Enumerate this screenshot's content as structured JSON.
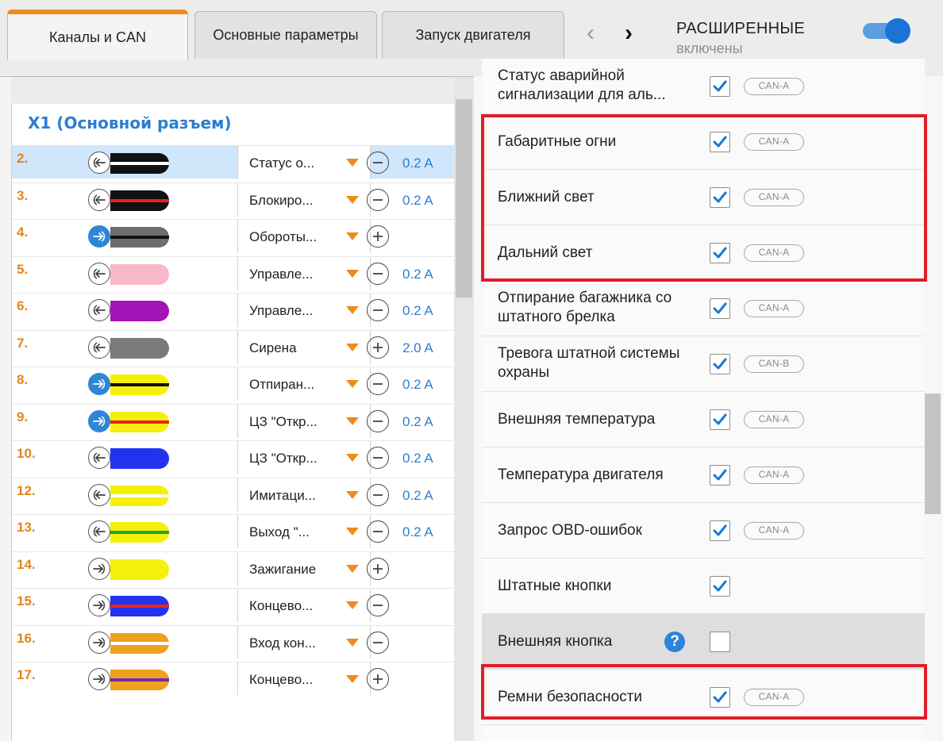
{
  "tabs": [
    {
      "label": "Каналы и CAN",
      "active": true
    },
    {
      "label": "Основные параметры",
      "active": false
    },
    {
      "label": "Запуск двигателя",
      "active": false
    }
  ],
  "nav": {
    "prev": "‹",
    "next": "›"
  },
  "advanced": {
    "title": "РАСШИРЕННЫЕ",
    "subtitle": "включены",
    "enabled": true
  },
  "connector": {
    "title": "X1 (Основной разъем)",
    "channels": [
      {
        "num": "2.",
        "dir": "out",
        "dir_active": false,
        "wire": "#111111",
        "stripe": "#ffffff",
        "func": "Статус о...",
        "polarity": "minus",
        "current": "0.2 A",
        "selected": true
      },
      {
        "num": "3.",
        "dir": "out",
        "dir_active": false,
        "wire": "#111111",
        "stripe": "#e8231c",
        "func": "Блокиро...",
        "polarity": "minus",
        "current": "0.2 A"
      },
      {
        "num": "4.",
        "dir": "in",
        "dir_active": true,
        "wire": "#6d6d6d",
        "stripe": "#111111",
        "func": "Обороты...",
        "polarity": "plus",
        "current": ""
      },
      {
        "num": "5.",
        "dir": "out",
        "dir_active": false,
        "wire": "#f7b8c8",
        "stripe": "",
        "func": "Управле...",
        "polarity": "minus",
        "current": "0.2 A"
      },
      {
        "num": "6.",
        "dir": "out",
        "dir_active": false,
        "wire": "#a313b5",
        "stripe": "",
        "func": "Управле...",
        "polarity": "minus",
        "current": "0.2 A"
      },
      {
        "num": "7.",
        "dir": "out",
        "dir_active": false,
        "wire": "#7a7a7a",
        "stripe": "",
        "func": "Сирена",
        "polarity": "plus",
        "current": "2.0 A"
      },
      {
        "num": "8.",
        "dir": "in",
        "dir_active": true,
        "wire": "#f5f00a",
        "stripe": "#111111",
        "func": "Отпиран...",
        "polarity": "minus",
        "current": "0.2 A"
      },
      {
        "num": "9.",
        "dir": "in",
        "dir_active": true,
        "wire": "#f5f00a",
        "stripe": "#e8231c",
        "func": "ЦЗ \"Откр...",
        "polarity": "minus",
        "current": "0.2 A"
      },
      {
        "num": "10.",
        "dir": "out",
        "dir_active": false,
        "wire": "#2233f0",
        "stripe": "",
        "func": "ЦЗ \"Откр...",
        "polarity": "minus",
        "current": "0.2 A"
      },
      {
        "num": "12.",
        "dir": "out",
        "dir_active": false,
        "wire": "#f5f00a",
        "stripe": "#ffffff",
        "func": "Имитаци...",
        "polarity": "minus",
        "current": "0.2 A"
      },
      {
        "num": "13.",
        "dir": "out",
        "dir_active": false,
        "wire": "#f5f00a",
        "stripe": "#1fa824",
        "func": "Выход \"...",
        "polarity": "minus",
        "current": "0.2 A"
      },
      {
        "num": "14.",
        "dir": "in",
        "dir_active": false,
        "wire": "#f5f00a",
        "stripe": "",
        "func": "Зажигание",
        "polarity": "plus",
        "current": ""
      },
      {
        "num": "15.",
        "dir": "in",
        "dir_active": false,
        "wire": "#2233f0",
        "stripe": "#e8231c",
        "func": "Концево...",
        "polarity": "minus",
        "current": ""
      },
      {
        "num": "16.",
        "dir": "in",
        "dir_active": false,
        "wire": "#f0a01c",
        "stripe": "#ffffff",
        "func": "Вход кон...",
        "polarity": "minus",
        "current": ""
      },
      {
        "num": "17.",
        "dir": "in",
        "dir_active": false,
        "wire": "#f0a01c",
        "stripe": "#6a2cb0",
        "func": "Концево...",
        "polarity": "plus",
        "current": ""
      }
    ]
  },
  "params": [
    {
      "label": "Статус аварийной сигнализации для аль...",
      "checked": true,
      "badge": "CAN-A",
      "highlight": false
    },
    {
      "label": "Габаритные огни",
      "checked": true,
      "badge": "CAN-A",
      "highlight": true
    },
    {
      "label": "Ближний свет",
      "checked": true,
      "badge": "CAN-A",
      "highlight": true
    },
    {
      "label": "Дальний свет",
      "checked": true,
      "badge": "CAN-A",
      "highlight": true
    },
    {
      "label": "Отпирание багажника со штатного брелка",
      "checked": true,
      "badge": "CAN-A",
      "highlight": false
    },
    {
      "label": "Тревога штатной системы охраны",
      "checked": true,
      "badge": "CAN-B",
      "highlight": false
    },
    {
      "label": "Внешняя температура",
      "checked": true,
      "badge": "CAN-A",
      "highlight": false
    },
    {
      "label": "Температура двигателя",
      "checked": true,
      "badge": "CAN-A",
      "highlight": false
    },
    {
      "label": "Запрос OBD-ошибок",
      "checked": true,
      "badge": "CAN-A",
      "highlight": false
    },
    {
      "label": "Штатные кнопки",
      "checked": true,
      "badge": "",
      "highlight": false
    },
    {
      "label": "Внешняя кнопка",
      "checked": false,
      "badge": "",
      "help": "?",
      "disabled": true,
      "highlight": false
    },
    {
      "label": "Ремни безопасности",
      "checked": true,
      "badge": "CAN-A",
      "highlight": true
    }
  ],
  "colors": {
    "accent": "#f08a1c",
    "link": "#2a7fd1",
    "highlight": "#e01e2b",
    "toggle": "#1b73d6"
  }
}
